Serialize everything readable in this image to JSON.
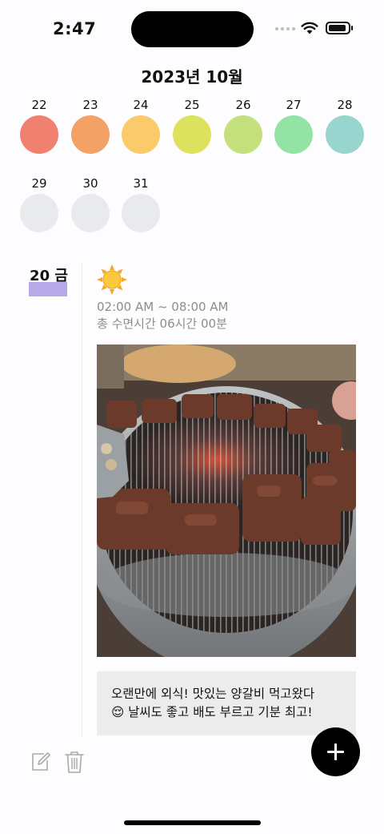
{
  "status_bar": {
    "time": "2:47"
  },
  "header": {
    "month_title": "2023년 10월"
  },
  "calendar": {
    "row1": [
      {
        "day": "22",
        "color": "#f08070"
      },
      {
        "day": "23",
        "color": "#f3a164"
      },
      {
        "day": "24",
        "color": "#fbca6a"
      },
      {
        "day": "25",
        "color": "#dde25e"
      },
      {
        "day": "26",
        "color": "#c3e07c"
      },
      {
        "day": "27",
        "color": "#93e3a5"
      },
      {
        "day": "28",
        "color": "#98d5cf"
      }
    ],
    "row2": [
      {
        "day": "29",
        "color": "#e9eaec"
      },
      {
        "day": "30",
        "color": "#e9eaec"
      },
      {
        "day": "31",
        "color": "#e9eaec"
      }
    ]
  },
  "entry": {
    "date_label": "20 금",
    "mood_color": "#b7a8e8",
    "weather_icon": "sun-icon",
    "sleep_range": "02:00 AM ~ 08:00 AM",
    "sleep_total": "총 수면시간 06시간 00분",
    "note_line1": "오랜만에 외식! 맛있는 양갈비 먹고왔다",
    "note_line2": "😌 날씨도 좋고 배도 부르고 기분 최고!"
  },
  "actions": {
    "edit_icon": "edit-icon",
    "trash_icon": "trash-icon",
    "add_icon": "plus-icon"
  }
}
